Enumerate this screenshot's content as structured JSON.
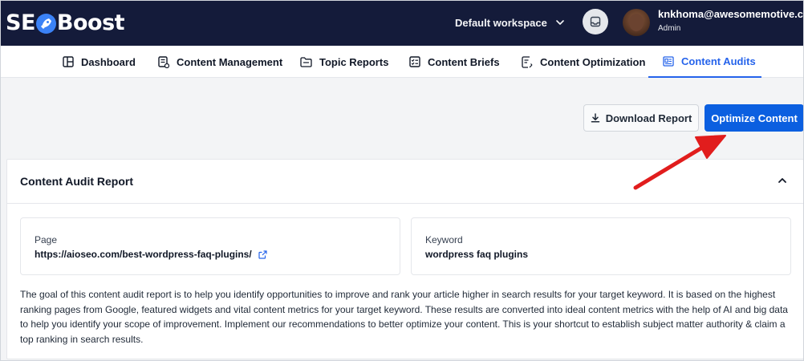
{
  "header": {
    "logo_text_pre": "SE",
    "logo_text_post": "Boost",
    "workspace_label": "Default workspace",
    "user_email": "knkhoma@awesomemotive.com",
    "user_role": "Admin"
  },
  "nav": {
    "items": [
      {
        "label": "Dashboard",
        "icon": "dashboard-icon"
      },
      {
        "label": "Content Management",
        "icon": "content-management-icon"
      },
      {
        "label": "Topic Reports",
        "icon": "folder-icon"
      },
      {
        "label": "Content Briefs",
        "icon": "checklist-icon"
      },
      {
        "label": "Content Optimization",
        "icon": "document-edit-icon"
      },
      {
        "label": "Content Audits",
        "icon": "audit-icon",
        "active": true
      }
    ]
  },
  "actions": {
    "download_label": "Download Report",
    "optimize_label": "Optimize Content"
  },
  "report": {
    "title": "Content Audit Report",
    "page_label": "Page",
    "page_value": "https://aioseo.com/best-wordpress-faq-plugins/",
    "keyword_label": "Keyword",
    "keyword_value": "wordpress faq plugins",
    "description": "The goal of this content audit report is to help you identify opportunities to improve and rank your article higher in search results for your target keyword. It is based on the highest ranking pages from Google, featured widgets and vital content metrics for your target keyword. These results are converted into ideal content metrics with the help of AI and big data to help you identify your scope of improvement. Implement our recommendations to better optimize your content. This is your shortcut to establish subject matter authority & claim a top ranking in search results."
  },
  "colors": {
    "topbar": "#141b3a",
    "primary": "#0b5fe0",
    "active_tab": "#2563eb",
    "annotation": "#e11d1d"
  }
}
